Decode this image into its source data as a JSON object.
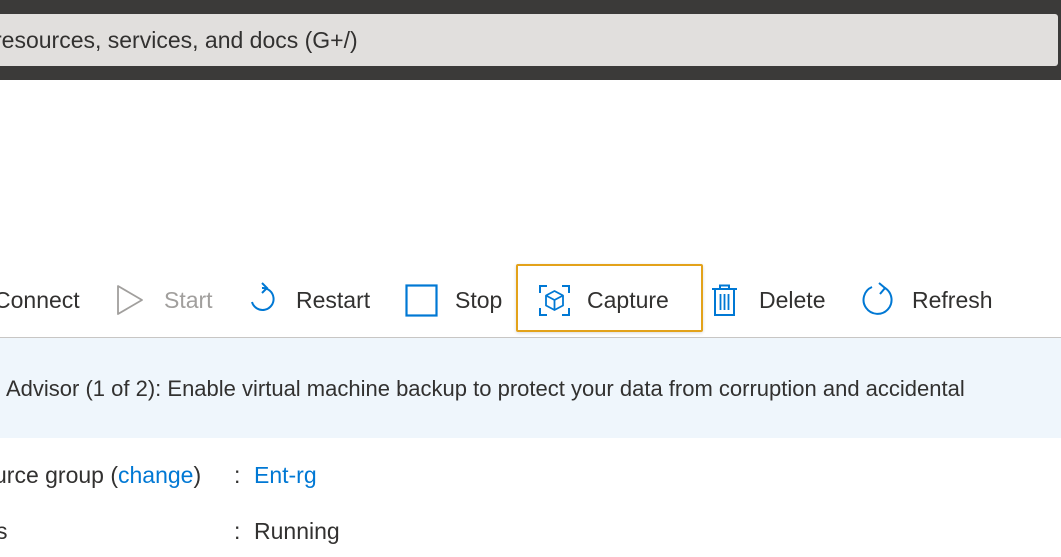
{
  "search": {
    "placeholder_text": "resources, services, and docs (G+/)"
  },
  "toolbar": {
    "connect_label": "Connect",
    "start_label": "Start",
    "restart_label": "Restart",
    "stop_label": "Stop",
    "capture_label": "Capture",
    "delete_label": "Delete",
    "refresh_label": "Refresh"
  },
  "advisor": {
    "message": "Advisor (1 of 2): Enable virtual machine backup to protect your data from corruption and accidental"
  },
  "essentials": {
    "resource_group_label": "urce group (",
    "change_link": "change",
    "resource_group_close": ")",
    "separator": ":",
    "resource_group_value": "Ent-rg",
    "status_label": "s",
    "status_value": "Running"
  },
  "colors": {
    "accent": "#0078d4",
    "highlight": "#e3a21a",
    "advisor_bg": "#eff6fc",
    "topbar": "#3b3a39"
  }
}
